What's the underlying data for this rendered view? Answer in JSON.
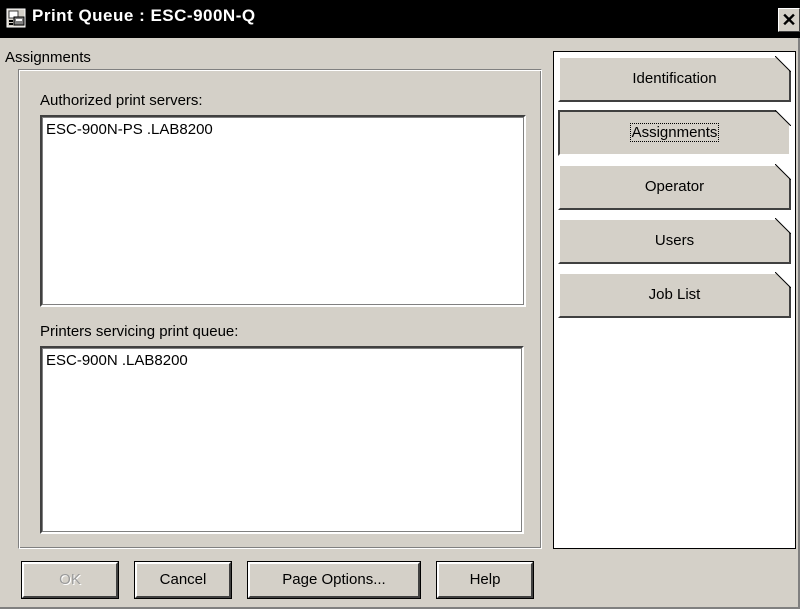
{
  "window": {
    "title": "Print Queue : ESC-900N-Q",
    "close_label": "✕"
  },
  "assignments": {
    "section_label": "Assignments",
    "servers_label": "Authorized print servers:",
    "servers": [
      "ESC-900N-PS .LAB8200"
    ],
    "printers_label": "Printers servicing print queue:",
    "printers": [
      "ESC-900N .LAB8200"
    ]
  },
  "tabs": [
    {
      "label": "Identification",
      "active": false
    },
    {
      "label": "Assignments",
      "active": true
    },
    {
      "label": "Operator",
      "active": false
    },
    {
      "label": "Users",
      "active": false
    },
    {
      "label": "Job List",
      "active": false
    }
  ],
  "buttons": {
    "ok": "OK",
    "cancel": "Cancel",
    "page_options": "Page Options...",
    "help": "Help"
  },
  "icons": {
    "app": "print-queue-icon",
    "close": "close-icon"
  }
}
